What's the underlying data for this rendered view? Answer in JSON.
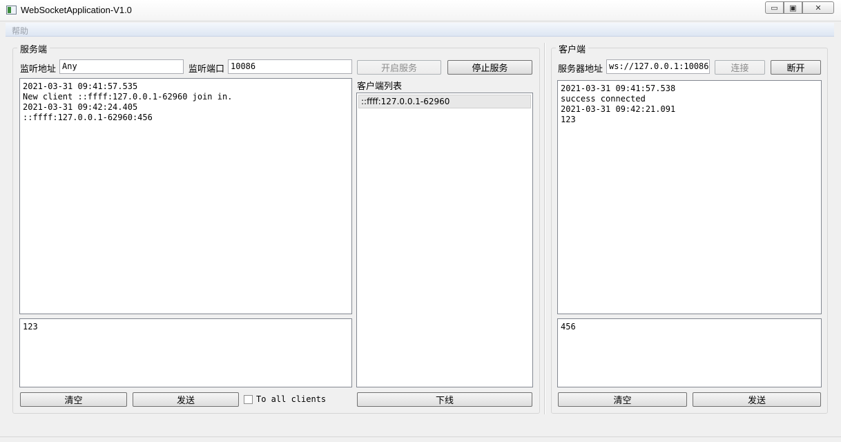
{
  "window": {
    "title": "WebSocketApplication-V1.0",
    "minimize": "▭",
    "maximize": "▣",
    "close": "✕"
  },
  "menu": {
    "help": "帮助"
  },
  "server": {
    "group_title": "服务端",
    "listen_addr_label": "监听地址",
    "listen_addr_value": "Any",
    "listen_port_label": "监听端口",
    "listen_port_value": "10086",
    "start_button": "开启服务",
    "stop_button": "停止服务",
    "log_lines": [
      "2021-03-31 09:41:57.535",
      "New client ::ffff:127.0.0.1-62960 join in.",
      "2021-03-31 09:42:24.405",
      "::ffff:127.0.0.1-62960:456"
    ],
    "send_text": "123",
    "clear_button": "清空",
    "send_button": "发送",
    "to_all_label": "To all clients",
    "client_list_label": "客户端列表",
    "clients": [
      "::ffff:127.0.0.1-62960"
    ],
    "offline_button": "下线"
  },
  "client": {
    "group_title": "客户端",
    "server_addr_label": "服务器地址",
    "server_addr_value": "ws://127.0.0.1:10086",
    "connect_button": "连接",
    "disconnect_button": "断开",
    "log_lines": [
      "2021-03-31 09:41:57.538",
      "success connected",
      "2021-03-31 09:42:21.091",
      "123"
    ],
    "send_text": "456",
    "clear_button": "清空",
    "send_button": "发送"
  }
}
